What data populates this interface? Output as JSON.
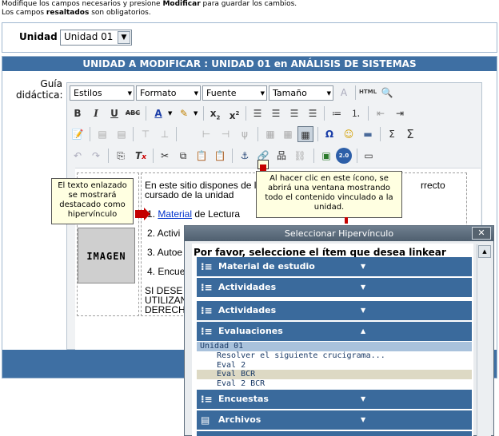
{
  "instructions": {
    "line1_pre": "Modifique los campos necesarios y presione ",
    "line1_bold": "Modificar",
    "line1_post": " para guardar los cambios.",
    "line2_pre": "Los campos ",
    "line2_bold": "resaltados",
    "line2_post": " son obligatorios."
  },
  "unit": {
    "label": "Unidad",
    "value": "Unidad 01"
  },
  "panel": {
    "title": "UNIDAD A MODIFICAR : UNIDAD 01 en ANÁLISIS DE SISTEMAS"
  },
  "field": {
    "label": "Guía didáctica:"
  },
  "toolbar": {
    "styles": "Estilos",
    "format": "Formato",
    "font": "Fuente",
    "size": "Tamaño",
    "html_label": "HTML",
    "version_badge": "2.0"
  },
  "document": {
    "intro_line1": "En este sitio dispones de l",
    "intro_line1_end": "rrecto",
    "intro_line2": "cursado de la unidad",
    "item1_num": "1. ",
    "item1_link": "Material",
    "item1_rest": " de Lectura",
    "item2": "2. Activi",
    "item3": "3. Autoe",
    "item4": "4. Encue",
    "tail1": "SI DESE",
    "tail2": "UTILIZAN",
    "tail3": "DERECH",
    "image_label": "IMAGEN"
  },
  "callouts": {
    "left": "El texto enlazado se mostrará destacado como hipervínculo",
    "right": "Al hacer clic en este ícono, se abrirá una ventana mostrando todo el contenido vinculado a la unidad."
  },
  "modal": {
    "title": "Seleccionar Hipervínculo",
    "prompt": "Por favor, seleccione el ítem que desea linkear",
    "categories": [
      {
        "label": "Material de estudio",
        "expanded": false
      },
      {
        "label": "Actividades",
        "expanded": false
      },
      {
        "label": "Actividades",
        "expanded": false
      },
      {
        "label": "Evaluaciones",
        "expanded": true
      },
      {
        "label": "Encuestas",
        "expanded": false
      },
      {
        "label": "Archivos",
        "expanded": false
      }
    ],
    "eval_group": "Unidad 01",
    "eval_items": [
      "Resolver el siguiente crucigrama...",
      "Eval 2",
      "Eval BCR",
      "Eval 2 BCR"
    ],
    "highlight_color": "#ddd9c4",
    "header_color": "#3a6a9c"
  },
  "colors": {
    "brand": "#3e6fa3",
    "callout_bg": "#ffffe1",
    "arrow": "#c40000"
  }
}
